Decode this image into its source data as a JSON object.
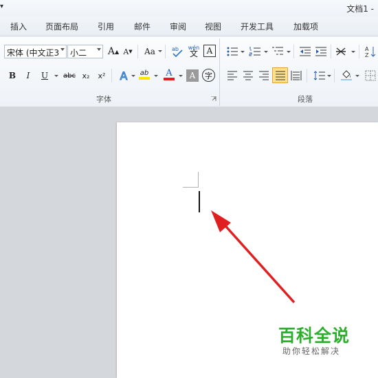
{
  "window": {
    "title": "文档1 -",
    "qat_glyph": "▾"
  },
  "tabs": [
    "插入",
    "页面布局",
    "引用",
    "邮件",
    "审阅",
    "视图",
    "开发工具",
    "加载项"
  ],
  "font_group": {
    "label": "字体",
    "font_name": "宋体 (中文正3",
    "font_size": "小二",
    "grow_font": "A",
    "shrink_font": "A",
    "change_case": "Aa",
    "phonetic_guide": "wén",
    "char_border": "A",
    "bold": "B",
    "italic": "I",
    "underline": "U",
    "strikethrough": "abc",
    "subscript": "x₂",
    "superscript": "x²",
    "text_effect": "A",
    "highlight": "ab",
    "font_color": "A",
    "char_shading": "A",
    "enclose_char": "字"
  },
  "paragraph_group": {
    "label": "段落"
  },
  "colors": {
    "highlight": "#f7e600",
    "font_color": "#e0201a",
    "arrow": "#e02020",
    "accent": "#2eae2e"
  },
  "watermark": {
    "main": "百科全说",
    "sub": "助你轻松解决"
  }
}
